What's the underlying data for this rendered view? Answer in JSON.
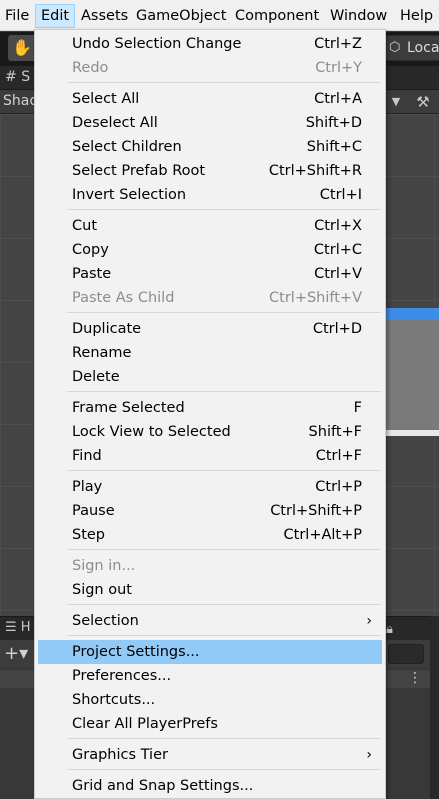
{
  "menubar": {
    "items": [
      {
        "label": "File",
        "active": false
      },
      {
        "label": "Edit",
        "active": true
      },
      {
        "label": "Assets",
        "active": false
      },
      {
        "label": "GameObject",
        "active": false
      },
      {
        "label": "Component",
        "active": false
      },
      {
        "label": "Window",
        "active": false
      },
      {
        "label": "Help",
        "active": false
      }
    ]
  },
  "background": {
    "local_button_label": "Loca",
    "scene_tab_partial": "S",
    "shading_label_partial": "Shac",
    "hierarchy_tab_partial": "H"
  },
  "edit_menu": {
    "items": [
      {
        "label": "Undo Selection Change",
        "shortcut": "Ctrl+Z",
        "disabled": false
      },
      {
        "label": "Redo",
        "shortcut": "Ctrl+Y",
        "disabled": true
      },
      {
        "label": "Select All",
        "shortcut": "Ctrl+A",
        "disabled": false
      },
      {
        "label": "Deselect All",
        "shortcut": "Shift+D",
        "disabled": false
      },
      {
        "label": "Select Children",
        "shortcut": "Shift+C",
        "disabled": false
      },
      {
        "label": "Select Prefab Root",
        "shortcut": "Ctrl+Shift+R",
        "disabled": false
      },
      {
        "label": "Invert Selection",
        "shortcut": "Ctrl+I",
        "disabled": false
      },
      {
        "label": "Cut",
        "shortcut": "Ctrl+X",
        "disabled": false
      },
      {
        "label": "Copy",
        "shortcut": "Ctrl+C",
        "disabled": false
      },
      {
        "label": "Paste",
        "shortcut": "Ctrl+V",
        "disabled": false
      },
      {
        "label": "Paste As Child",
        "shortcut": "Ctrl+Shift+V",
        "disabled": true
      },
      {
        "label": "Duplicate",
        "shortcut": "Ctrl+D",
        "disabled": false
      },
      {
        "label": "Rename",
        "shortcut": "",
        "disabled": false
      },
      {
        "label": "Delete",
        "shortcut": "",
        "disabled": false
      },
      {
        "label": "Frame Selected",
        "shortcut": "F",
        "disabled": false
      },
      {
        "label": "Lock View to Selected",
        "shortcut": "Shift+F",
        "disabled": false
      },
      {
        "label": "Find",
        "shortcut": "Ctrl+F",
        "disabled": false
      },
      {
        "label": "Play",
        "shortcut": "Ctrl+P",
        "disabled": false
      },
      {
        "label": "Pause",
        "shortcut": "Ctrl+Shift+P",
        "disabled": false
      },
      {
        "label": "Step",
        "shortcut": "Ctrl+Alt+P",
        "disabled": false
      },
      {
        "label": "Sign in...",
        "shortcut": "",
        "disabled": true
      },
      {
        "label": "Sign out",
        "shortcut": "",
        "disabled": false
      },
      {
        "label": "Selection",
        "shortcut": "",
        "disabled": false,
        "submenu": true
      },
      {
        "label": "Project Settings...",
        "shortcut": "",
        "disabled": false,
        "highlighted": true
      },
      {
        "label": "Preferences...",
        "shortcut": "",
        "disabled": false
      },
      {
        "label": "Shortcuts...",
        "shortcut": "",
        "disabled": false
      },
      {
        "label": "Clear All PlayerPrefs",
        "shortcut": "",
        "disabled": false
      },
      {
        "label": "Graphics Tier",
        "shortcut": "",
        "disabled": false,
        "submenu": true
      },
      {
        "label": "Grid and Snap Settings...",
        "shortcut": "",
        "disabled": false
      }
    ],
    "submenu_arrow": "›"
  }
}
